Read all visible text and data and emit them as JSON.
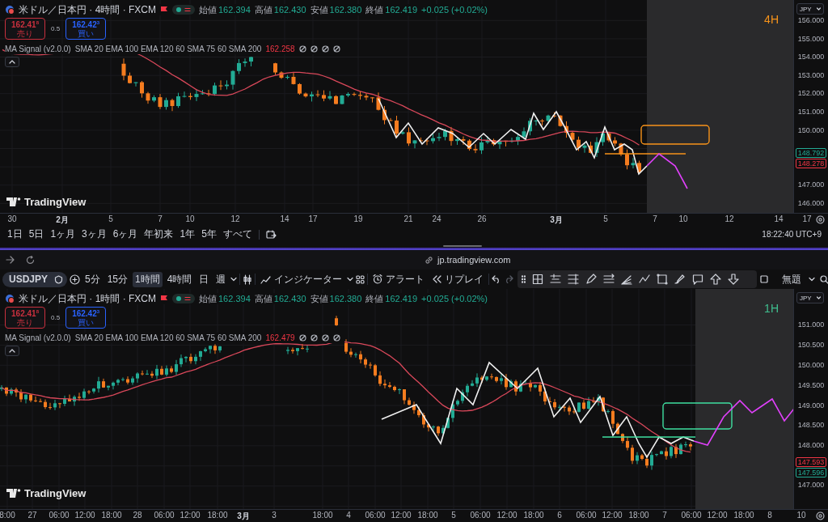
{
  "panels": [
    {
      "title": "米ドル／日本円 · 4時間 · FXCM",
      "ohlc": [
        {
          "label": "始値",
          "value": "162.394"
        },
        {
          "label": "高値",
          "value": "162.430"
        },
        {
          "label": "安値",
          "value": "162.380"
        },
        {
          "label": "終値",
          "value": "162.419"
        }
      ],
      "change": "+0.025 (+0.02%)",
      "sell": {
        "price": "162.41$^{8}$",
        "label": "売り"
      },
      "spread": "0.5",
      "buy": {
        "price": "162.42$^{3}$",
        "label": "買い"
      },
      "indicator": {
        "name": "MA Signal (v2.0.0)",
        "params": "SMA 20 EMA 100 EMA 120 60 SMA 75 60 SMA 200",
        "value": "162.258"
      },
      "timeframe": {
        "label": "4H",
        "color": "#f7931a"
      },
      "currency": "JPY",
      "logo": "TradingView",
      "price_labels_upper": [
        "156.000",
        "155.000",
        "154.000",
        "153.000",
        "152.000",
        "151.000",
        "150.000"
      ],
      "price_badges": [
        {
          "text": "148.792",
          "color": "#22ab94"
        },
        {
          "text": "148.278",
          "color": "#f23645"
        }
      ],
      "price_labels_lower": [
        "147.000",
        "146.000"
      ],
      "time_labels": [
        {
          "text": "30",
          "kind": "day"
        },
        {
          "text": "2月",
          "kind": "month"
        },
        {
          "text": "5",
          "kind": "day"
        },
        {
          "text": "7",
          "kind": "day"
        },
        {
          "text": "10",
          "kind": "day"
        },
        {
          "text": "12",
          "kind": "day"
        },
        {
          "text": "14",
          "kind": "day"
        },
        {
          "text": "17",
          "kind": "day"
        },
        {
          "text": "19",
          "kind": "day"
        },
        {
          "text": "21",
          "kind": "day"
        },
        {
          "text": "24",
          "kind": "day"
        },
        {
          "text": "26",
          "kind": "day"
        },
        {
          "text": "3月",
          "kind": "month"
        },
        {
          "text": "5",
          "kind": "day"
        },
        {
          "text": "7",
          "kind": "day"
        },
        {
          "text": "10",
          "kind": "day"
        },
        {
          "text": "12",
          "kind": "day"
        },
        {
          "text": "14",
          "kind": "day"
        },
        {
          "text": "17",
          "kind": "day"
        }
      ]
    },
    {
      "title": "米ドル／日本円 · 1時間 · FXCM",
      "ohlc": [
        {
          "label": "始値",
          "value": "162.394"
        },
        {
          "label": "高値",
          "value": "162.430"
        },
        {
          "label": "安値",
          "value": "162.380"
        },
        {
          "label": "終値",
          "value": "162.419"
        }
      ],
      "change": "+0.025 (+0.02%)",
      "sell": {
        "price": "162.41$^{8}$",
        "label": "売り"
      },
      "spread": "0.5",
      "buy": {
        "price": "162.42$^{3}$",
        "label": "買い"
      },
      "indicator": {
        "name": "MA Signal (v2.0.0)",
        "params": "SMA 20 EMA 100 EMA 120 60 SMA 75 60 SMA 200",
        "value": "162.479"
      },
      "timeframe": {
        "label": "1H",
        "color": "#3fbf8f"
      },
      "currency": "JPY",
      "logo": "TradingView",
      "price_labels_upper": [
        "151.000",
        "150.500",
        "150.000",
        "149.500",
        "149.000",
        "148.500",
        "148.000"
      ],
      "price_badges": [
        {
          "text": "147.593",
          "color": "#f23645"
        },
        {
          "text": "147.596",
          "color": "#22ab94"
        }
      ],
      "price_labels_lower": [
        "147.000"
      ],
      "time_labels": [
        {
          "text": "8:00",
          "kind": "day"
        },
        {
          "text": "27",
          "kind": "day"
        },
        {
          "text": "06:00",
          "kind": "day"
        },
        {
          "text": "12:00",
          "kind": "day"
        },
        {
          "text": "18:00",
          "kind": "day"
        },
        {
          "text": "28",
          "kind": "day"
        },
        {
          "text": "06:00",
          "kind": "day"
        },
        {
          "text": "12:00",
          "kind": "day"
        },
        {
          "text": "18:00",
          "kind": "day"
        },
        {
          "text": "3月",
          "kind": "month"
        },
        {
          "text": "3",
          "kind": "day"
        },
        {
          "text": "18:00",
          "kind": "day"
        },
        {
          "text": "4",
          "kind": "day"
        },
        {
          "text": "06:00",
          "kind": "day"
        },
        {
          "text": "12:00",
          "kind": "day"
        },
        {
          "text": "18:00",
          "kind": "day"
        },
        {
          "text": "5",
          "kind": "day"
        },
        {
          "text": "06:00",
          "kind": "day"
        },
        {
          "text": "12:00",
          "kind": "day"
        },
        {
          "text": "18:00",
          "kind": "day"
        },
        {
          "text": "6",
          "kind": "day"
        },
        {
          "text": "06:00",
          "kind": "day"
        },
        {
          "text": "12:00",
          "kind": "day"
        },
        {
          "text": "18:00",
          "kind": "day"
        },
        {
          "text": "7",
          "kind": "day"
        },
        {
          "text": "06:00",
          "kind": "day"
        },
        {
          "text": "12:00",
          "kind": "day"
        },
        {
          "text": "18:00",
          "kind": "day"
        },
        {
          "text": "8",
          "kind": "day"
        },
        {
          "text": "10",
          "kind": "day"
        }
      ]
    }
  ],
  "range_bar": {
    "ranges": [
      "1日",
      "5日",
      "1ヶ月",
      "3ヶ月",
      "6ヶ月",
      "年初来",
      "1年",
      "5年",
      "すべて"
    ],
    "clock": "18:22:40 UTC+9"
  },
  "browser": {
    "url": "jp.tradingview.com"
  },
  "toolbar": {
    "symbol": "USDJPY",
    "intervals": [
      {
        "label": "5分",
        "selected": false
      },
      {
        "label": "15分",
        "selected": false
      },
      {
        "label": "1時間",
        "selected": true
      },
      {
        "label": "4時間",
        "selected": false
      },
      {
        "label": "日",
        "selected": false
      },
      {
        "label": "週",
        "selected": false
      }
    ],
    "indicators": "インジケーター",
    "alert": "アラート",
    "replay": "リプレイ",
    "layout_name": "無題"
  }
}
